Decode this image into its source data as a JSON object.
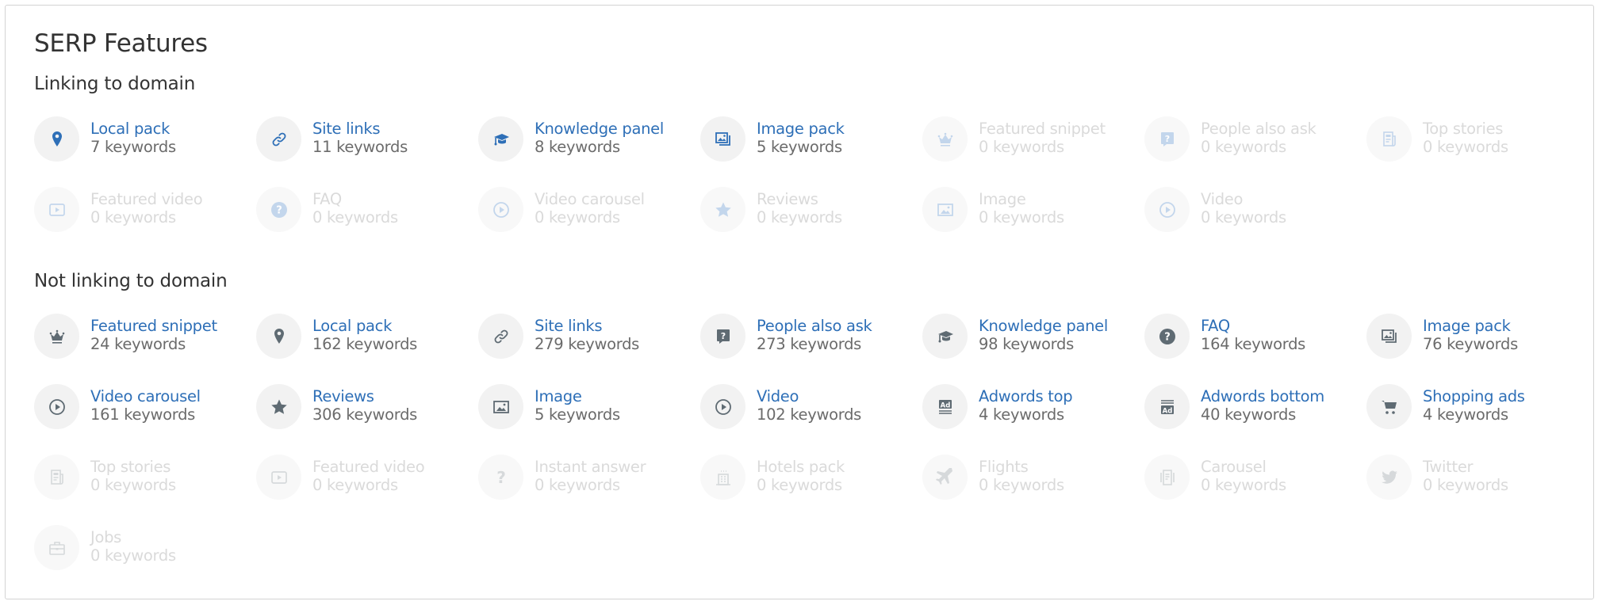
{
  "title": "SERP Features",
  "colors": {
    "link_blue": "#2e6fb7",
    "icon_linking": "#2e6fb7",
    "icon_not_linking": "#5f6b73",
    "icon_linking_inactive": "#c3d6ec",
    "icon_not_linking_inactive": "#d6d9db",
    "count_gray": "#6b6b6b",
    "inactive_text": "#dadada"
  },
  "sections": [
    {
      "heading": "Linking to domain",
      "variant": "linking",
      "items": [
        {
          "name": "Local pack",
          "count": "7 keywords",
          "icon": "map-pin-icon",
          "active": true
        },
        {
          "name": "Site links",
          "count": "11 keywords",
          "icon": "link-icon",
          "active": true
        },
        {
          "name": "Knowledge panel",
          "count": "8 keywords",
          "icon": "graduation-cap-icon",
          "active": true
        },
        {
          "name": "Image pack",
          "count": "5 keywords",
          "icon": "image-pack-icon",
          "active": true
        },
        {
          "name": "Featured snippet",
          "count": "0 keywords",
          "icon": "crown-icon",
          "active": false
        },
        {
          "name": "People also ask",
          "count": "0 keywords",
          "icon": "question-bubble-icon",
          "active": false
        },
        {
          "name": "Top stories",
          "count": "0 keywords",
          "icon": "newspaper-icon",
          "active": false
        },
        {
          "name": "Featured video",
          "count": "0 keywords",
          "icon": "video-frame-icon",
          "active": false
        },
        {
          "name": "FAQ",
          "count": "0 keywords",
          "icon": "question-circle-icon",
          "active": false
        },
        {
          "name": "Video carousel",
          "count": "0 keywords",
          "icon": "play-circle-icon",
          "active": false
        },
        {
          "name": "Reviews",
          "count": "0 keywords",
          "icon": "star-icon",
          "active": false
        },
        {
          "name": "Image",
          "count": "0 keywords",
          "icon": "image-icon",
          "active": false
        },
        {
          "name": "Video",
          "count": "0 keywords",
          "icon": "play-circle-icon",
          "active": false
        }
      ]
    },
    {
      "heading": "Not linking to domain",
      "variant": "not-linking",
      "items": [
        {
          "name": "Featured snippet",
          "count": "24 keywords",
          "icon": "crown-icon",
          "active": true
        },
        {
          "name": "Local pack",
          "count": "162 keywords",
          "icon": "map-pin-icon",
          "active": true
        },
        {
          "name": "Site links",
          "count": "279 keywords",
          "icon": "link-icon",
          "active": true
        },
        {
          "name": "People also ask",
          "count": "273 keywords",
          "icon": "question-bubble-icon",
          "active": true
        },
        {
          "name": "Knowledge panel",
          "count": "98 keywords",
          "icon": "graduation-cap-icon",
          "active": true
        },
        {
          "name": "FAQ",
          "count": "164 keywords",
          "icon": "question-circle-icon",
          "active": true
        },
        {
          "name": "Image pack",
          "count": "76 keywords",
          "icon": "image-pack-icon",
          "active": true
        },
        {
          "name": "Video carousel",
          "count": "161 keywords",
          "icon": "play-circle-icon",
          "active": true
        },
        {
          "name": "Reviews",
          "count": "306 keywords",
          "icon": "star-icon",
          "active": true
        },
        {
          "name": "Image",
          "count": "5 keywords",
          "icon": "image-icon",
          "active": true
        },
        {
          "name": "Video",
          "count": "102 keywords",
          "icon": "play-circle-icon",
          "active": true
        },
        {
          "name": "Adwords top",
          "count": "4 keywords",
          "icon": "ad-top-icon",
          "active": true
        },
        {
          "name": "Adwords bottom",
          "count": "40 keywords",
          "icon": "ad-bottom-icon",
          "active": true
        },
        {
          "name": "Shopping ads",
          "count": "4 keywords",
          "icon": "shopping-cart-icon",
          "active": true
        },
        {
          "name": "Top stories",
          "count": "0 keywords",
          "icon": "newspaper-icon",
          "active": false
        },
        {
          "name": "Featured video",
          "count": "0 keywords",
          "icon": "video-frame-icon",
          "active": false
        },
        {
          "name": "Instant answer",
          "count": "0 keywords",
          "icon": "question-mark-icon",
          "active": false
        },
        {
          "name": "Hotels pack",
          "count": "0 keywords",
          "icon": "hotel-icon",
          "active": false
        },
        {
          "name": "Flights",
          "count": "0 keywords",
          "icon": "plane-icon",
          "active": false
        },
        {
          "name": "Carousel",
          "count": "0 keywords",
          "icon": "carousel-icon",
          "active": false
        },
        {
          "name": "Twitter",
          "count": "0 keywords",
          "icon": "twitter-icon",
          "active": false
        },
        {
          "name": "Jobs",
          "count": "0 keywords",
          "icon": "briefcase-icon",
          "active": false
        }
      ]
    }
  ]
}
